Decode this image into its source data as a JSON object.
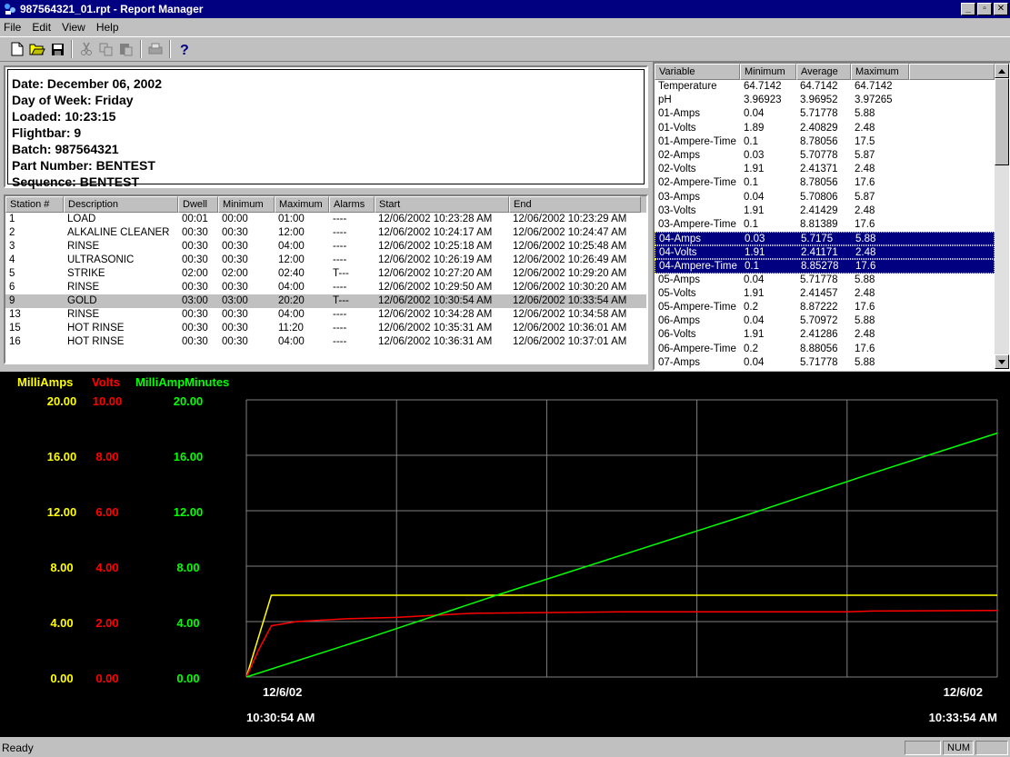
{
  "window": {
    "title": "987564321_01.rpt - Report Manager",
    "minimize_glyph": "_",
    "maximize_glyph": "▫",
    "close_glyph": "✕"
  },
  "menu": {
    "file": "File",
    "edit": "Edit",
    "view": "View",
    "help": "Help"
  },
  "toolbar": {
    "icons": [
      "new-file-icon",
      "open-folder-icon",
      "save-icon",
      "cut-icon",
      "copy-icon",
      "paste-icon",
      "print-icon",
      "help-icon"
    ]
  },
  "info": {
    "date": "Date: December 06, 2002",
    "day": "Day of Week: Friday",
    "loaded": "Loaded: 10:23:15",
    "flightbar": "Flightbar: 9",
    "batch": "Batch: 987564321",
    "part": "Part Number: BENTEST",
    "sequence": "Sequence: BENTEST"
  },
  "stations": {
    "headers": [
      "Station #",
      "Description",
      "Dwell",
      "Minimum",
      "Maximum",
      "Alarms",
      "Start",
      "End"
    ],
    "rows": [
      [
        "1",
        "LOAD",
        "00:01",
        "00:00",
        "01:00",
        "----",
        "12/06/2002 10:23:28 AM",
        "12/06/2002 10:23:29 AM"
      ],
      [
        "2",
        "ALKALINE CLEANER",
        "00:30",
        "00:30",
        "12:00",
        "----",
        "12/06/2002 10:24:17 AM",
        "12/06/2002 10:24:47 AM"
      ],
      [
        "3",
        "RINSE",
        "00:30",
        "00:30",
        "04:00",
        "----",
        "12/06/2002 10:25:18 AM",
        "12/06/2002 10:25:48 AM"
      ],
      [
        "4",
        "ULTRASONIC",
        "00:30",
        "00:30",
        "12:00",
        "----",
        "12/06/2002 10:26:19 AM",
        "12/06/2002 10:26:49 AM"
      ],
      [
        "5",
        "STRIKE",
        "02:00",
        "02:00",
        "02:40",
        "T---",
        "12/06/2002 10:27:20 AM",
        "12/06/2002 10:29:20 AM"
      ],
      [
        "6",
        "RINSE",
        "00:30",
        "00:30",
        "04:00",
        "----",
        "12/06/2002 10:29:50 AM",
        "12/06/2002 10:30:20 AM"
      ],
      [
        "9",
        "GOLD",
        "03:00",
        "03:00",
        "20:20",
        "T---",
        "12/06/2002 10:30:54 AM",
        "12/06/2002 10:33:54 AM"
      ],
      [
        "13",
        "RINSE",
        "00:30",
        "00:30",
        "04:00",
        "----",
        "12/06/2002 10:34:28 AM",
        "12/06/2002 10:34:58 AM"
      ],
      [
        "15",
        "HOT RINSE",
        "00:30",
        "00:30",
        "11:20",
        "----",
        "12/06/2002 10:35:31 AM",
        "12/06/2002 10:36:01 AM"
      ],
      [
        "16",
        "HOT RINSE",
        "00:30",
        "00:30",
        "04:00",
        "----",
        "12/06/2002 10:36:31 AM",
        "12/06/2002 10:37:01 AM"
      ]
    ],
    "highlighted_row": 6
  },
  "variables": {
    "headers": [
      "Variable",
      "Minimum",
      "Average",
      "Maximum"
    ],
    "rows": [
      [
        "Temperature",
        "64.7142",
        "64.7142",
        "64.7142"
      ],
      [
        "pH",
        "3.96923",
        "3.96952",
        "3.97265"
      ],
      [
        "01-Amps",
        "0.04",
        "5.71778",
        "5.88"
      ],
      [
        "01-Volts",
        "1.89",
        "2.40829",
        "2.48"
      ],
      [
        "01-Ampere-Time",
        "0.1",
        "8.78056",
        "17.5"
      ],
      [
        "02-Amps",
        "0.03",
        "5.70778",
        "5.87"
      ],
      [
        "02-Volts",
        "1.91",
        "2.41371",
        "2.48"
      ],
      [
        "02-Ampere-Time",
        "0.1",
        "8.78056",
        "17.6"
      ],
      [
        "03-Amps",
        "0.04",
        "5.70806",
        "5.87"
      ],
      [
        "03-Volts",
        "1.91",
        "2.41429",
        "2.48"
      ],
      [
        "03-Ampere-Time",
        "0.1",
        "8.81389",
        "17.6"
      ],
      [
        "04-Amps",
        "0.03",
        "5.7175",
        "5.88"
      ],
      [
        "04-Volts",
        "1.91",
        "2.41171",
        "2.48"
      ],
      [
        "04-Ampere-Time",
        "0.1",
        "8.85278",
        "17.6"
      ],
      [
        "05-Amps",
        "0.04",
        "5.71778",
        "5.88"
      ],
      [
        "05-Volts",
        "1.91",
        "2.41457",
        "2.48"
      ],
      [
        "05-Ampere-Time",
        "0.2",
        "8.87222",
        "17.6"
      ],
      [
        "06-Amps",
        "0.04",
        "5.70972",
        "5.88"
      ],
      [
        "06-Volts",
        "1.91",
        "2.41286",
        "2.48"
      ],
      [
        "06-Ampere-Time",
        "0.2",
        "8.88056",
        "17.6"
      ],
      [
        "07-Amps",
        "0.04",
        "5.71778",
        "5.88"
      ]
    ],
    "selected_rows": [
      11,
      12,
      13
    ]
  },
  "chart_data": {
    "type": "line",
    "axes": [
      {
        "label": "MilliAmps",
        "color": "#ffff00",
        "ticks": [
          "20.00",
          "16.00",
          "12.00",
          "8.00",
          "4.00",
          "0.00"
        ],
        "ylim": [
          0,
          20
        ]
      },
      {
        "label": "Volts",
        "color": "#ff0000",
        "ticks": [
          "10.00",
          "8.00",
          "6.00",
          "4.00",
          "2.00",
          "0.00"
        ],
        "ylim": [
          0,
          10
        ]
      },
      {
        "label": "MilliAmpMinutes",
        "color": "#00ff00",
        "ticks": [
          "20.00",
          "16.00",
          "12.00",
          "8.00",
          "4.00",
          "0.00"
        ],
        "ylim": [
          0,
          20
        ]
      }
    ],
    "x_start_date": "12/6/02",
    "x_start_time": "10:30:54 AM",
    "x_end_date": "12/6/02",
    "x_end_time": "10:33:54 AM",
    "x_range_minutes": [
      0,
      3
    ],
    "grid": true,
    "series": [
      {
        "name": "MilliAmps",
        "color": "#ffff00",
        "axis": 0,
        "points": [
          [
            0,
            0
          ],
          [
            0.1,
            5.9
          ],
          [
            3,
            5.9
          ]
        ]
      },
      {
        "name": "Volts",
        "color": "#ff0000",
        "axis": 1,
        "points": [
          [
            0,
            0
          ],
          [
            0.05,
            1.0
          ],
          [
            0.1,
            1.85
          ],
          [
            0.2,
            2.0
          ],
          [
            0.4,
            2.1
          ],
          [
            0.6,
            2.15
          ],
          [
            0.9,
            2.3
          ],
          [
            1.5,
            2.35
          ],
          [
            2.4,
            2.35
          ],
          [
            2.5,
            2.38
          ],
          [
            3,
            2.4
          ]
        ]
      },
      {
        "name": "MilliAmpMinutes",
        "color": "#00ff00",
        "axis": 2,
        "points": [
          [
            0,
            0
          ],
          [
            0.5,
            2.9
          ],
          [
            1.0,
            5.9
          ],
          [
            1.5,
            8.8
          ],
          [
            2.0,
            11.7
          ],
          [
            2.5,
            14.7
          ],
          [
            3,
            17.6
          ]
        ]
      }
    ]
  },
  "status": {
    "text": "Ready",
    "num": "NUM"
  }
}
